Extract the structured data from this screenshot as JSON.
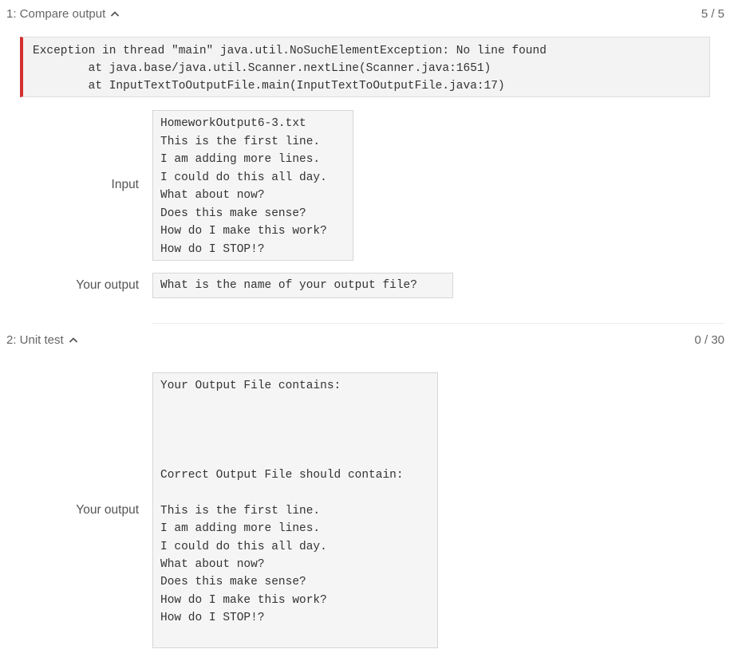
{
  "section1": {
    "title": "1: Compare output",
    "score": "5 / 5",
    "exception_text": "Exception in thread \"main\" java.util.NoSuchElementException: No line found\n        at java.base/java.util.Scanner.nextLine(Scanner.java:1651)\n        at InputTextToOutputFile.main(InputTextToOutputFile.java:17)",
    "input_label": "Input",
    "input_text": "HomeworkOutput6-3.txt\nThis is the first line.\nI am adding more lines.\nI could do this all day.\nWhat about now?\nDoes this make sense?\nHow do I make this work?\nHow do I STOP!?",
    "output_label": "Your output",
    "output_text": "What is the name of your output file?"
  },
  "section2": {
    "title": "2: Unit test",
    "score": "0 / 30",
    "output_label": "Your output",
    "output_text": "Your Output File contains:\n\n\n\n\nCorrect Output File should contain:\n\nThis is the first line.\nI am adding more lines.\nI could do this all day.\nWhat about now?\nDoes this make sense?\nHow do I make this work?\nHow do I STOP!?"
  },
  "icons": {
    "collapse": "chevron-up-icon",
    "error_bar": "#d32f2f"
  }
}
